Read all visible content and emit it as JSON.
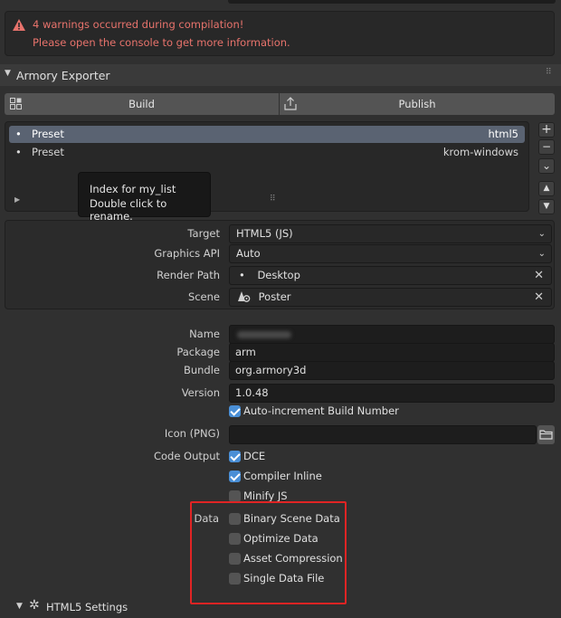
{
  "warning": {
    "line1": "4 warnings occurred during compilation!",
    "line2": "Please open the console to get more information."
  },
  "panel": {
    "title": "Armory Exporter",
    "build_label": "Build",
    "publish_label": "Publish"
  },
  "presets": [
    {
      "bullet": "•",
      "name": "Preset",
      "target": "html5"
    },
    {
      "bullet": "•",
      "name": "Preset",
      "target": "krom-windows"
    }
  ],
  "tooltip": {
    "line1": "Index for my_list",
    "line2": "Double click to rename."
  },
  "side_buttons": {
    "add": "+",
    "remove": "−",
    "menu": "⌄",
    "up": "▲",
    "down": "▼"
  },
  "settings": {
    "target_label": "Target",
    "target_value": "HTML5 (JS)",
    "graphics_api_label": "Graphics API",
    "graphics_api_value": "Auto",
    "render_path_label": "Render Path",
    "render_path_value": "Desktop",
    "scene_label": "Scene",
    "scene_value": "Poster"
  },
  "project": {
    "name_label": "Name",
    "name_value": "",
    "package_label": "Package",
    "package_value": "arm",
    "bundle_label": "Bundle",
    "bundle_value": "org.armory3d",
    "version_label": "Version",
    "version_value": "1.0.48",
    "auto_increment_label": "Auto-increment Build Number",
    "icon_label": "Icon (PNG)",
    "icon_value": ""
  },
  "code_output": {
    "label": "Code Output",
    "options": [
      {
        "label": "DCE",
        "checked": true
      },
      {
        "label": "Compiler Inline",
        "checked": true
      },
      {
        "label": "Minify JS",
        "checked": false
      }
    ]
  },
  "data_options": {
    "label": "Data",
    "options": [
      {
        "label": "Binary Scene Data",
        "checked": false
      },
      {
        "label": "Optimize Data",
        "checked": false
      },
      {
        "label": "Asset Compression",
        "checked": false
      },
      {
        "label": "Single Data File",
        "checked": false
      }
    ]
  },
  "html5_settings": {
    "label": "HTML5 Settings"
  },
  "colors": {
    "warning_text": "#e8736c",
    "highlight": "#e02424",
    "checkbox_on": "#4a8fd6",
    "selected_row": "#5a6372"
  }
}
